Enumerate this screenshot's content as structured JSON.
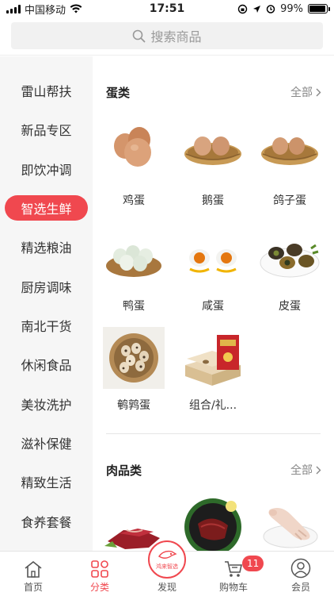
{
  "status_bar": {
    "carrier": "中国移动",
    "time": "17:51",
    "battery": "99%"
  },
  "search": {
    "placeholder": "搜索商品"
  },
  "sidebar": {
    "items": [
      "雷山帮扶",
      "新品专区",
      "即饮冲调",
      "智选生鲜",
      "精选粮油",
      "厨房调味",
      "南北干货",
      "休闲食品",
      "美妆洗护",
      "滋补保健",
      "精致生活",
      "食养套餐"
    ],
    "active": "智选生鲜"
  },
  "sections": [
    {
      "title": "蛋类",
      "all_label": "全部",
      "items": [
        "鸡蛋",
        "鹅蛋",
        "鸽子蛋",
        "鸭蛋",
        "咸蛋",
        "皮蛋",
        "鹌鹑蛋",
        "组合/礼..."
      ]
    },
    {
      "title": "肉品类",
      "all_label": "全部",
      "items": [
        "",
        "",
        ""
      ]
    }
  ],
  "tabbar": {
    "home": "首页",
    "category": "分类",
    "discover": "发现",
    "cart": "购物车",
    "member": "会员",
    "cart_badge": "11",
    "center_logo": "鸿来智选"
  },
  "colors": {
    "accent": "#f0484f"
  }
}
